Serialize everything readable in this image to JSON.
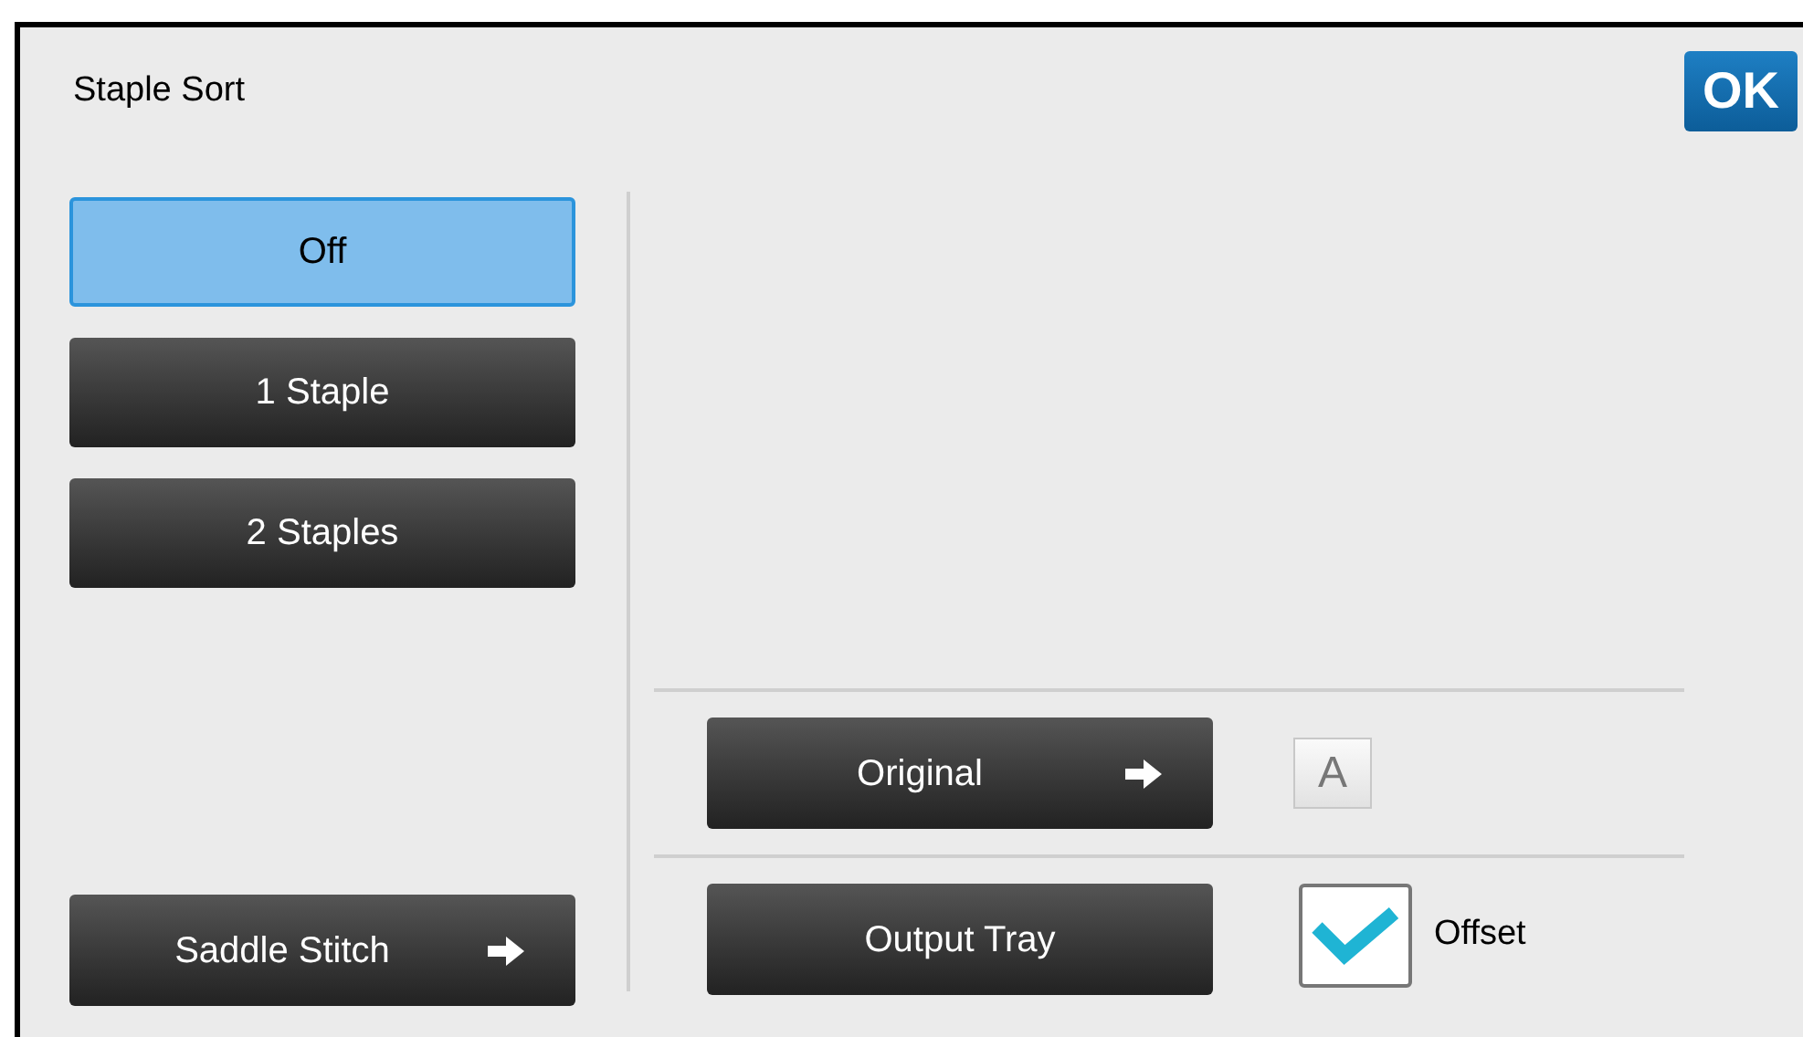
{
  "title": "Staple Sort",
  "ok_button": "OK",
  "staple_options": [
    {
      "label": "Off",
      "selected": true
    },
    {
      "label": "1 Staple",
      "selected": false
    },
    {
      "label": "2 Staples",
      "selected": false
    }
  ],
  "saddle_stitch": {
    "label": "Saddle Stitch",
    "arrow": true
  },
  "original": {
    "label": "Original",
    "arrow": true,
    "indicator": "A"
  },
  "output_tray": {
    "label": "Output Tray",
    "arrow": false
  },
  "offset": {
    "label": "Offset",
    "checked": true
  }
}
